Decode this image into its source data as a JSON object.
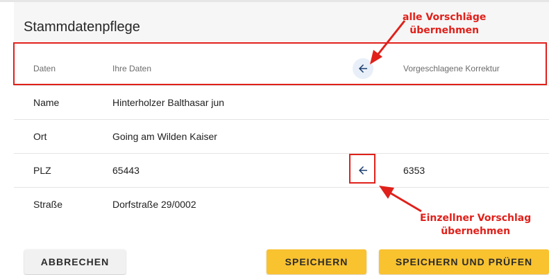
{
  "header": {
    "title": "Stammdatenpflege"
  },
  "columns": {
    "data": "Daten",
    "own": "Ihre Daten",
    "suggested": "Vorgeschlagene Korrektur"
  },
  "rows": [
    {
      "field": "Name",
      "own": "Hinterholzer Balthasar jun",
      "suggested": ""
    },
    {
      "field": "Ort",
      "own": "Going am Wilden Kaiser",
      "suggested": ""
    },
    {
      "field": "PLZ",
      "own": "65443",
      "suggested": "6353"
    },
    {
      "field": "Straße",
      "own": "Dorfstraße 29/0002",
      "suggested": ""
    }
  ],
  "annotations": {
    "all_suggestions_line1": "alle Vorschläge",
    "all_suggestions_line2": "übernehmen",
    "single_suggestion_line1": "Einzellner Vorschlag",
    "single_suggestion_line2": "übernehmen"
  },
  "buttons": {
    "cancel": "ABBRECHEN",
    "save": "SPEICHERN",
    "save_check": "SPEICHERN UND PRÜFEN"
  },
  "icons": {
    "accept_all": "arrow-left-icon",
    "accept_single": "arrow-left-icon"
  },
  "colors": {
    "accent": "#f9c22f",
    "annotation": "#e0201a",
    "icon": "#1a3d6d"
  }
}
